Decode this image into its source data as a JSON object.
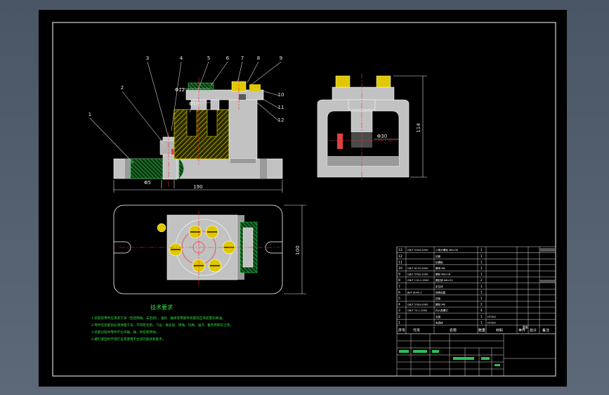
{
  "balloons": [
    "1",
    "2",
    "3",
    "4",
    "5",
    "6",
    "7",
    "8",
    "9",
    "10",
    "11",
    "12"
  ],
  "dimensions": {
    "front_width": "190",
    "front_left": "Φ5",
    "front_top_a": "Φ12",
    "front_top_b": "Φ10",
    "side_height": "114",
    "side_bore": "Φ30",
    "plan_height": "100"
  },
  "notes": {
    "title": "技术要求",
    "lines": [
      "1.装配前零件应清洗干净（包括倒角、去毛刺），油封、轴承等零部件装配前应涂适量润滑油。",
      "2.零件在装配前必须清理干净，不得有毛刺、飞边、氧化皮、锈蚀、切屑、油污、着色剂和灰尘等。",
      "3.装配过程中零件不允许磕、碰、划伤和锈蚀。",
      "4.螺钉紧固时不得打击或使用不合适的旋具和扳手。"
    ]
  },
  "bom": {
    "rows": [
      {
        "no": "13",
        "code": "GB/T 5783-2000",
        "name": "六角头螺栓 M8×30",
        "qty": "1",
        "mat": "",
        "note": ""
      },
      {
        "no": "12",
        "code": "",
        "name": "钻套",
        "qty": "1",
        "mat": "",
        "note": ""
      },
      {
        "no": "11",
        "code": "",
        "name": "钻模板",
        "qty": "1",
        "mat": "",
        "note": ""
      },
      {
        "no": "10",
        "code": "GB/T 6170-2000",
        "name": "螺母 M8",
        "qty": "1",
        "mat": "",
        "note": ""
      },
      {
        "no": "9",
        "code": "GB/T 5783-2000",
        "name": "螺栓 M8×16",
        "qty": "1",
        "mat": "",
        "note": ""
      },
      {
        "no": "8",
        "code": "GB/T 119.1-2000",
        "name": "圆柱销 Φ6×20",
        "qty": "2",
        "mat": "",
        "note": ""
      },
      {
        "no": "7",
        "code": "",
        "name": "定位块",
        "qty": "1",
        "mat": "",
        "note": ""
      },
      {
        "no": "6",
        "code": "JB/T 8045.1",
        "name": "快换钻套",
        "qty": "1",
        "mat": "",
        "note": ""
      },
      {
        "no": "5",
        "code": "",
        "name": "压板",
        "qty": "1",
        "mat": "",
        "note": ""
      },
      {
        "no": "4",
        "code": "GB/T 5783-2000",
        "name": "螺栓 M6",
        "qty": "2",
        "mat": "",
        "note": ""
      },
      {
        "no": "3",
        "code": "GB/T 70.1-2000",
        "name": "内六角螺钉",
        "qty": "4",
        "mat": "",
        "note": ""
      },
      {
        "no": "2",
        "code": "",
        "name": "支座",
        "qty": "1",
        "mat": "HT200",
        "note": ""
      },
      {
        "no": "1",
        "code": "",
        "name": "夹具体",
        "qty": "1",
        "mat": "HT200",
        "note": ""
      }
    ],
    "header": {
      "no": "序号",
      "code": "代号",
      "name": "名称",
      "qty": "数量",
      "mat": "材料",
      "note": "备注",
      "single": "单件",
      "total": "总计",
      "weight": "重量"
    }
  },
  "colors": {
    "sheet": "#000000",
    "border": "#ffffff",
    "body_fill": "#c2c2c2",
    "hatch": "#d8d800",
    "part_yellow": "#e0c800",
    "part_green": "#1e9a3a",
    "centerline": "#ff2a2a",
    "dim_line": "#e8e8e8",
    "leader": "#d0d0d0",
    "notes_text": "#33e040",
    "bom_text": "#ffffff",
    "bom_line": "#d9d9d9"
  }
}
